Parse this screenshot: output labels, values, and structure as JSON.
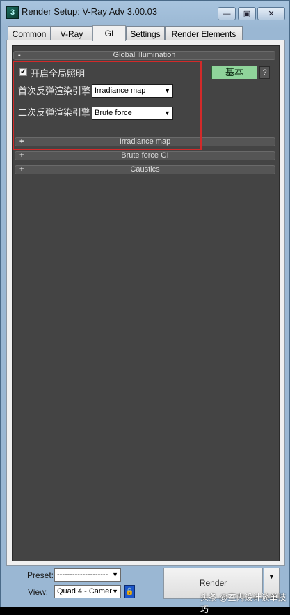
{
  "window": {
    "title": "Render Setup: V-Ray Adv 3.00.03",
    "app_icon_glyph": "3",
    "buttons": {
      "minimize": "—",
      "maximize": "▣",
      "close": "✕"
    }
  },
  "tabs": [
    {
      "label": "Common"
    },
    {
      "label": "V-Ray"
    },
    {
      "label": "GI",
      "active": true
    },
    {
      "label": "Settings"
    },
    {
      "label": "Render Elements"
    }
  ],
  "gi_rollout": {
    "sign": "-",
    "title": "Global illumination",
    "enable_checked": true,
    "enable_label": "开启全局照明",
    "primary_label": "首次反弹渲染引擎",
    "primary_value": "Irradiance map",
    "secondary_label": "二次反弹渲染引擎",
    "secondary_value": "Brute force",
    "mode_button": "基本",
    "help_button": "?"
  },
  "collapsed_rollouts": [
    {
      "sign": "+",
      "title": "Irradiance map"
    },
    {
      "sign": "+",
      "title": "Brute force GI"
    },
    {
      "sign": "+",
      "title": "Caustics"
    }
  ],
  "bottom": {
    "preset_label": "Preset:",
    "preset_value": "--------------------",
    "view_label": "View:",
    "view_value": "Quad 4 - Camer",
    "render_button": "Render",
    "lock_icon": "lock-icon"
  },
  "watermark": "头条 @室内设计谈单技巧",
  "colors": {
    "highlight_box": "#d22a2a",
    "mode_button": "#8fd49a",
    "rollout_bg": "#444444"
  }
}
